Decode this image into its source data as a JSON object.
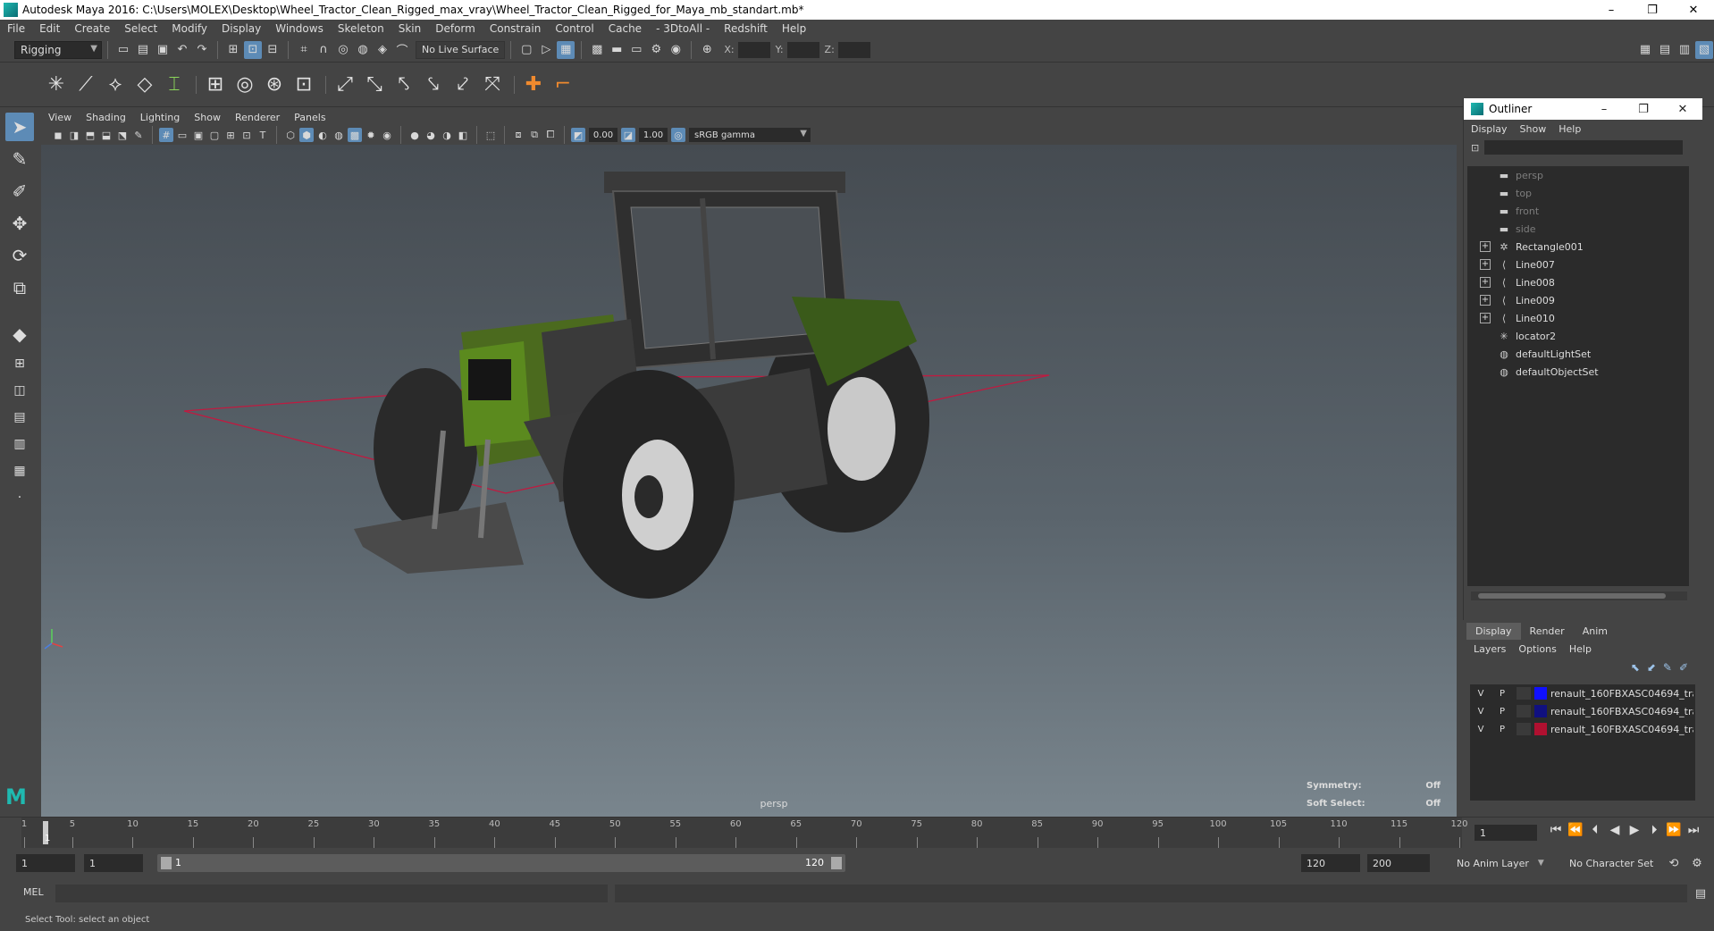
{
  "window": {
    "title": "Autodesk Maya 2016: C:\\Users\\MOLEX\\Desktop\\Wheel_Tractor_Clean_Rigged_max_vray\\Wheel_Tractor_Clean_Rigged_for_Maya_mb_standart.mb*",
    "minimize": "–",
    "restore": "❐",
    "close": "✕"
  },
  "menus": [
    "File",
    "Edit",
    "Create",
    "Select",
    "Modify",
    "Display",
    "Windows",
    "Skeleton",
    "Skin",
    "Deform",
    "Constrain",
    "Control",
    "Cache",
    "- 3DtoAll -",
    "Redshift",
    "Help"
  ],
  "status": {
    "mode": "Rigging",
    "live_surface": "No Live Surface",
    "x_label": "X:",
    "y_label": "Y:",
    "z_label": "Z:"
  },
  "panel": {
    "menus": [
      "View",
      "Shading",
      "Lighting",
      "Show",
      "Renderer",
      "Panels"
    ],
    "value1": "0.00",
    "value2": "1.00",
    "color_space": "sRGB gamma",
    "camera": "persp",
    "symmetry_label": "Symmetry:",
    "symmetry_value": "Off",
    "soft_select_label": "Soft Select:",
    "soft_select_value": "Off"
  },
  "outliner": {
    "title": "Outliner",
    "menus": [
      "Display",
      "Show",
      "Help"
    ],
    "items": [
      {
        "name": "persp",
        "icon": "camera-icon",
        "expandable": false,
        "dim": true
      },
      {
        "name": "top",
        "icon": "camera-icon",
        "expandable": false,
        "dim": true
      },
      {
        "name": "front",
        "icon": "camera-icon",
        "expandable": false,
        "dim": true
      },
      {
        "name": "side",
        "icon": "camera-icon",
        "expandable": false,
        "dim": true
      },
      {
        "name": "Rectangle001",
        "icon": "transform-icon",
        "expandable": true,
        "dim": false
      },
      {
        "name": "Line007",
        "icon": "curve-icon",
        "expandable": true,
        "dim": false
      },
      {
        "name": "Line008",
        "icon": "curve-icon",
        "expandable": true,
        "dim": false
      },
      {
        "name": "Line009",
        "icon": "curve-icon",
        "expandable": true,
        "dim": false
      },
      {
        "name": "Line010",
        "icon": "curve-icon",
        "expandable": true,
        "dim": false
      },
      {
        "name": "locator2",
        "icon": "locator-icon",
        "expandable": false,
        "dim": false
      },
      {
        "name": "defaultLightSet",
        "icon": "set-icon",
        "expandable": false,
        "dim": false
      },
      {
        "name": "defaultObjectSet",
        "icon": "set-icon",
        "expandable": false,
        "dim": false
      }
    ]
  },
  "layers": {
    "tabs": [
      "Display",
      "Render",
      "Anim"
    ],
    "menus": [
      "Layers",
      "Options",
      "Help"
    ],
    "rows": [
      {
        "v": "V",
        "p": "P",
        "color": "#1010ff",
        "name": "renault_160FBXASC04694_tract"
      },
      {
        "v": "V",
        "p": "P",
        "color": "#101080",
        "name": "renault_160FBXASC04694_tract"
      },
      {
        "v": "V",
        "p": "P",
        "color": "#b01030",
        "name": "renault_160FBXASC04694_tract"
      }
    ]
  },
  "timeline": {
    "ticks": [
      "1",
      "5",
      "10",
      "15",
      "20",
      "25",
      "30",
      "35",
      "40",
      "45",
      "50",
      "55",
      "60",
      "65",
      "70",
      "75",
      "80",
      "85",
      "90",
      "95",
      "100",
      "105",
      "110",
      "115",
      "120"
    ],
    "current_frame": "1",
    "current_field": "1"
  },
  "range": {
    "start": "1",
    "start2": "1",
    "range_start": "1",
    "range_end": "120",
    "end": "120",
    "end2": "200",
    "anim_layer": "No Anim Layer",
    "character_set": "No Character Set"
  },
  "command": {
    "label": "MEL"
  },
  "help_line": "Select Tool: select an object",
  "colors": {
    "accent": "#5d8bb6",
    "maya_teal": "#1fb9b0"
  }
}
